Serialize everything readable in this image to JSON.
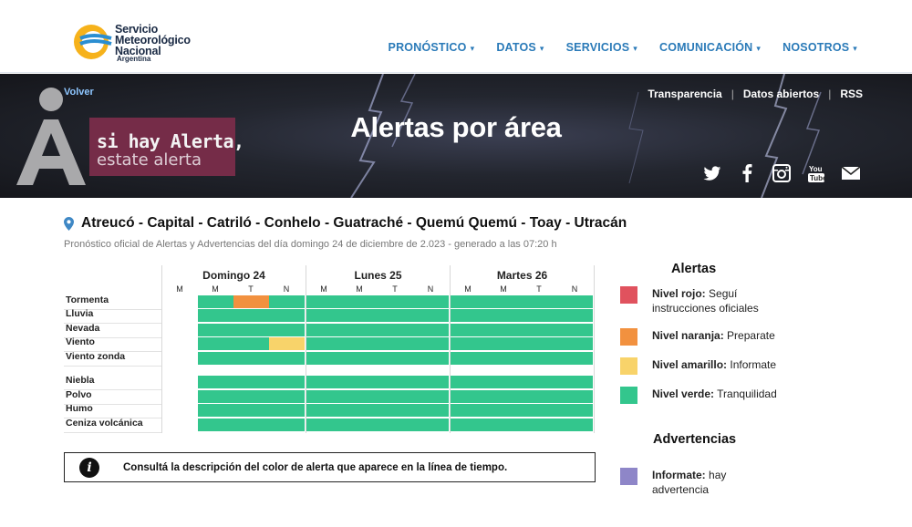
{
  "header": {
    "logo_lines": [
      "Servicio",
      "Meteorológico",
      "Nacional"
    ],
    "logo_sub": "Argentina",
    "nav": [
      {
        "label": "PRONÓSTICO",
        "icon": "caret-down-icon"
      },
      {
        "label": "DATOS",
        "icon": "caret-down-icon"
      },
      {
        "label": "SERVICIOS",
        "icon": "caret-down-icon"
      },
      {
        "label": "COMUNICACIÓN",
        "icon": "caret-down-icon"
      },
      {
        "label": "NOSOTROS",
        "icon": "caret-down-icon"
      }
    ]
  },
  "banner": {
    "back": "Volver",
    "links": [
      "Transparencia",
      "Datos abiertos",
      "RSS"
    ],
    "title": "Alertas por área",
    "badge_line1": "si hay Alerta,",
    "badge_line2": "estate alerta",
    "social_icons": [
      "twitter-icon",
      "facebook-icon",
      "instagram-icon",
      "youtube-icon",
      "mail-icon"
    ]
  },
  "location": {
    "icon": "map-pin-icon",
    "title": "Atreucó - Capital - Catriló - Conhelo - Guatraché - Quemú Quemú - Toay - Utracán",
    "subtitle": "Pronóstico oficial de Alertas y Advertencias del día domingo 24 de diciembre de 2.023 - generado a las 07:20 h"
  },
  "timeline": {
    "days": [
      "Domingo 24",
      "Lunes 25",
      "Martes 26"
    ],
    "slots": [
      "M",
      "M",
      "T",
      "N"
    ],
    "colors": {
      "verde": "#33c68d",
      "naranja": "#f2913f",
      "amarillo": "#f8d36a",
      "rojo": "#e0525e"
    },
    "rows": [
      {
        "label": "Tormenta",
        "levels": [
          "none",
          "verde",
          "naranja",
          "verde",
          "verde",
          "verde",
          "verde",
          "verde",
          "verde",
          "verde",
          "verde",
          "verde"
        ]
      },
      {
        "label": "Lluvia",
        "levels": [
          "none",
          "verde",
          "verde",
          "verde",
          "verde",
          "verde",
          "verde",
          "verde",
          "verde",
          "verde",
          "verde",
          "verde"
        ]
      },
      {
        "label": "Nevada",
        "levels": [
          "none",
          "verde",
          "verde",
          "verde",
          "verde",
          "verde",
          "verde",
          "verde",
          "verde",
          "verde",
          "verde",
          "verde"
        ]
      },
      {
        "label": "Viento",
        "levels": [
          "none",
          "verde",
          "verde",
          "amarillo",
          "verde",
          "verde",
          "verde",
          "verde",
          "verde",
          "verde",
          "verde",
          "verde"
        ]
      },
      {
        "label": "Viento zonda",
        "levels": [
          "none",
          "verde",
          "verde",
          "verde",
          "verde",
          "verde",
          "verde",
          "verde",
          "verde",
          "verde",
          "verde",
          "verde"
        ]
      },
      {
        "label": "Niebla",
        "levels": [
          "none",
          "verde",
          "verde",
          "verde",
          "verde",
          "verde",
          "verde",
          "verde",
          "verde",
          "verde",
          "verde",
          "verde"
        ]
      },
      {
        "label": "Polvo",
        "levels": [
          "none",
          "verde",
          "verde",
          "verde",
          "verde",
          "verde",
          "verde",
          "verde",
          "verde",
          "verde",
          "verde",
          "verde"
        ]
      },
      {
        "label": "Humo",
        "levels": [
          "none",
          "verde",
          "verde",
          "verde",
          "verde",
          "verde",
          "verde",
          "verde",
          "verde",
          "verde",
          "verde",
          "verde"
        ]
      },
      {
        "label": "Ceniza volcánica",
        "levels": [
          "none",
          "verde",
          "verde",
          "verde",
          "verde",
          "verde",
          "verde",
          "verde",
          "verde",
          "verde",
          "verde",
          "verde"
        ]
      }
    ]
  },
  "info": {
    "icon": "info-icon",
    "text": "Consultá la descripción del color de alerta que aparece en la línea de tiempo."
  },
  "legend": {
    "alertas_title": "Alertas",
    "alertas": [
      {
        "name": "Nivel rojo:",
        "desc": "Seguí instrucciones oficiales",
        "color": "#e0525e"
      },
      {
        "name": "Nivel naranja:",
        "desc": "Preparate",
        "color": "#f2913f"
      },
      {
        "name": "Nivel amarillo:",
        "desc": "Informate",
        "color": "#f8d36a"
      },
      {
        "name": "Nivel verde:",
        "desc": "Tranquilidad",
        "color": "#33c68d"
      }
    ],
    "advertencias_title": "Advertencias",
    "advertencias": [
      {
        "name": "Informate:",
        "desc": "hay advertencia",
        "color": "#8e86c8"
      }
    ]
  }
}
